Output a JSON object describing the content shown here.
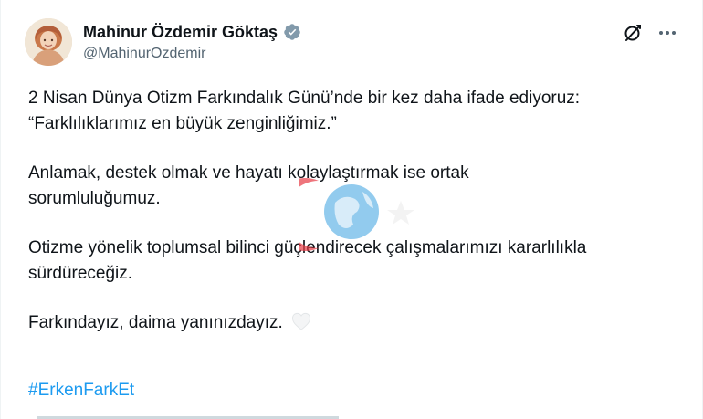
{
  "author": {
    "display_name": "Mahinur Özdemir Göktaş",
    "handle": "@MahinurOzdemir",
    "verified": true
  },
  "icons": {
    "verified": "verified-badge-icon",
    "grok": "grok-icon",
    "more": "more-options-icon",
    "heart": "white-heart-icon"
  },
  "tweet": {
    "paragraph_1_line_1": "2 Nisan Dünya Otizm Farkındalık Günü’nde bir kez daha ifade ediyoruz:",
    "paragraph_1_line_2": "“Farklılıklarımız en büyük zenginliğimiz.”",
    "paragraph_2_line_1": "Anlamak, destek olmak ve hayatı kolaylaştırmak ise ortak",
    "paragraph_2_line_2": "sorumluluğumuz.",
    "paragraph_3_line_1": "Otizme yönelik toplumsal bilinci güçlendirecek çalışmalarımızı kararlılıkla",
    "paragraph_3_line_2": "sürdüreceğiz.",
    "paragraph_4": "Farkındayız, daima yanınızdayız.",
    "hashtag": "#ErkenFarkEt"
  },
  "colors": {
    "text": "#0f1419",
    "secondary": "#536471",
    "link": "#1d9bf0",
    "verified": "#829aab"
  }
}
